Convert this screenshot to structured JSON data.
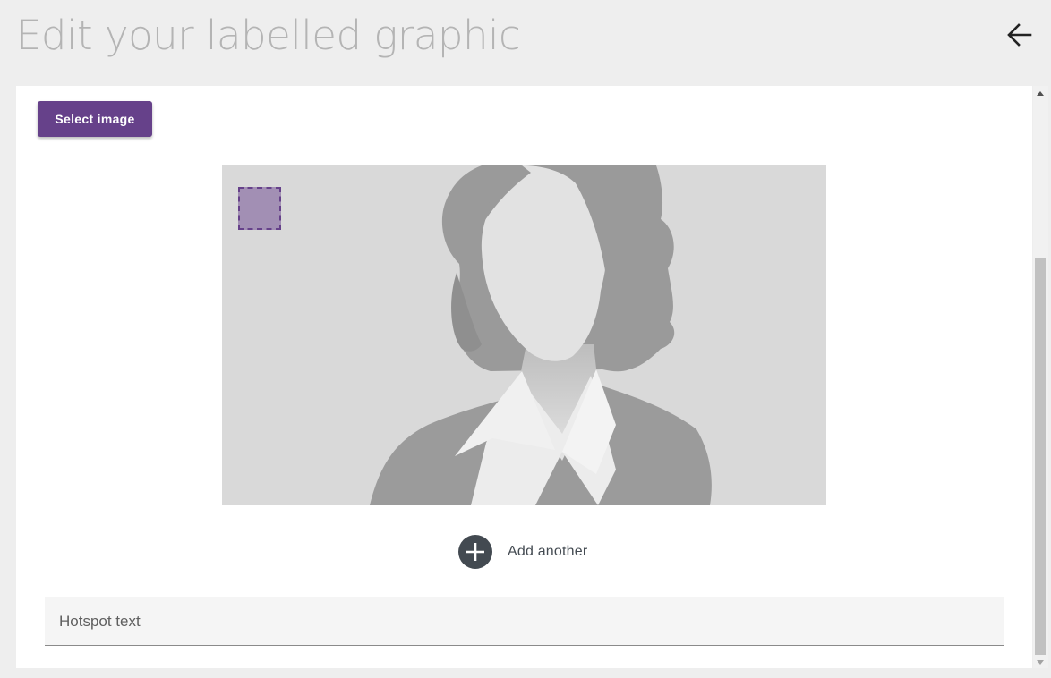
{
  "header": {
    "title": "Edit your labelled graphic",
    "back_icon": "arrow-left-icon"
  },
  "toolbar": {
    "select_image_label": "Select image"
  },
  "graphic": {
    "icon": "placeholder-woman-silhouette",
    "hotspot_color": "#a28fb4",
    "hotspot_border_color": "#66418a"
  },
  "add_another": {
    "icon": "plus-circle-icon",
    "label": "Add another"
  },
  "hotspot_text": {
    "placeholder": "Hotspot text",
    "value": ""
  },
  "colors": {
    "accent": "#66418a",
    "background": "#eeeeee",
    "panel": "#ffffff"
  }
}
